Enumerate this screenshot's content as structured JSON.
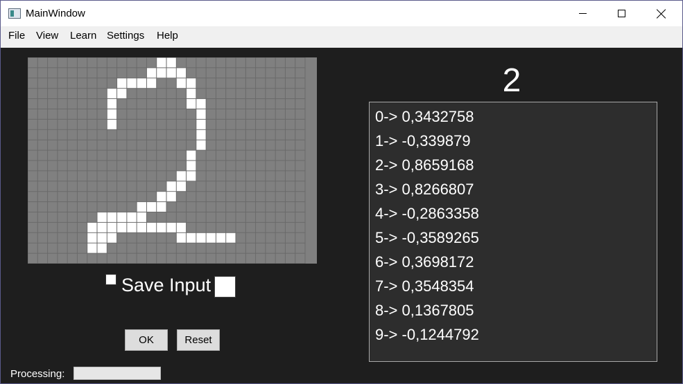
{
  "window": {
    "title": "MainWindow"
  },
  "titlebar": {
    "icon": "app-icon",
    "controls": [
      "minimize-icon",
      "maximize-icon",
      "close-icon"
    ]
  },
  "menu": {
    "file": "File",
    "view": "View",
    "learn": "Learn",
    "settings": "Settings",
    "help": "Help"
  },
  "grid": {
    "cols": 28,
    "rows": 20,
    "cell_color": "#808080",
    "line_color": "#6a6a6a",
    "fill_color": "#ffffff",
    "filled": [
      [
        13,
        0
      ],
      [
        14,
        0
      ],
      [
        12,
        1
      ],
      [
        13,
        1
      ],
      [
        14,
        1
      ],
      [
        15,
        1
      ],
      [
        9,
        2
      ],
      [
        10,
        2
      ],
      [
        11,
        2
      ],
      [
        12,
        2
      ],
      [
        15,
        2
      ],
      [
        16,
        2
      ],
      [
        8,
        3
      ],
      [
        9,
        3
      ],
      [
        16,
        3
      ],
      [
        8,
        4
      ],
      [
        16,
        4
      ],
      [
        17,
        4
      ],
      [
        8,
        5
      ],
      [
        17,
        5
      ],
      [
        8,
        6
      ],
      [
        17,
        6
      ],
      [
        17,
        7
      ],
      [
        17,
        8
      ],
      [
        16,
        9
      ],
      [
        16,
        10
      ],
      [
        15,
        11
      ],
      [
        16,
        11
      ],
      [
        14,
        12
      ],
      [
        15,
        12
      ],
      [
        13,
        13
      ],
      [
        14,
        13
      ],
      [
        11,
        14
      ],
      [
        12,
        14
      ],
      [
        13,
        14
      ],
      [
        7,
        15
      ],
      [
        8,
        15
      ],
      [
        9,
        15
      ],
      [
        10,
        15
      ],
      [
        11,
        15
      ],
      [
        6,
        16
      ],
      [
        7,
        16
      ],
      [
        8,
        16
      ],
      [
        9,
        16
      ],
      [
        10,
        16
      ],
      [
        11,
        16
      ],
      [
        12,
        16
      ],
      [
        13,
        16
      ],
      [
        14,
        16
      ],
      [
        15,
        16
      ],
      [
        6,
        17
      ],
      [
        7,
        17
      ],
      [
        8,
        17
      ],
      [
        15,
        17
      ],
      [
        16,
        17
      ],
      [
        17,
        17
      ],
      [
        18,
        17
      ],
      [
        19,
        17
      ],
      [
        20,
        17
      ],
      [
        6,
        18
      ],
      [
        7,
        18
      ]
    ]
  },
  "save_input": {
    "label": "Save Input",
    "checked": false
  },
  "buttons": {
    "ok": "OK",
    "reset": "Reset"
  },
  "status": {
    "processing_label": "Processing:",
    "progress": 0
  },
  "prediction": "2",
  "results": [
    "0-> 0,3432758",
    "1-> -0,339879",
    "2-> 0,8659168",
    "3-> 0,8266807",
    "4-> -0,2863358",
    "5-> -0,3589265",
    "6-> 0,3698172",
    "7-> 0,3548354",
    "8-> 0,1367805",
    "9-> -0,1244792"
  ]
}
